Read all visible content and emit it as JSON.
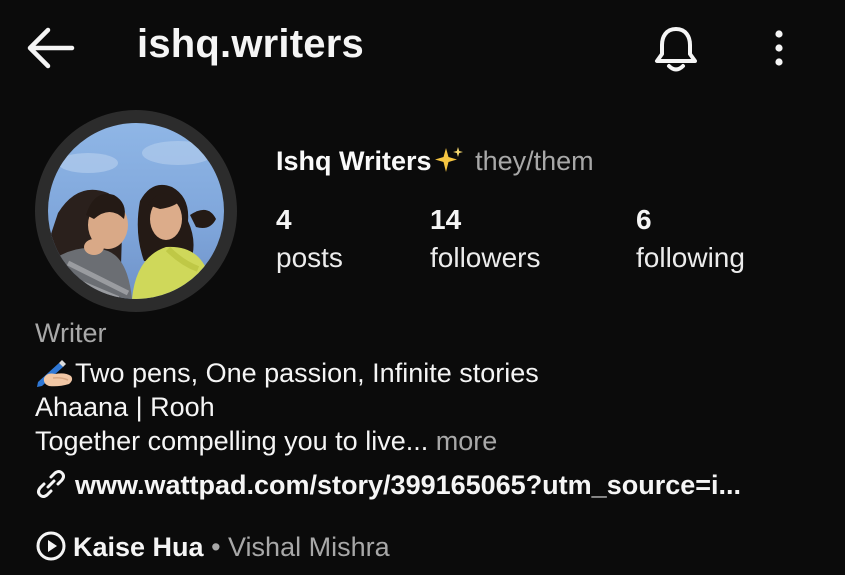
{
  "header": {
    "back_icon": "arrow-left-icon",
    "username": "ishq.writers",
    "bell_icon": "bell-icon",
    "menu_icon": "more-vertical-icon"
  },
  "profile": {
    "display_name": "Ishq Writers",
    "name_emoji": "sparkles-icon",
    "pronouns": "they/them",
    "stats": [
      {
        "value": "4",
        "label": "posts"
      },
      {
        "value": "14",
        "label": "followers"
      },
      {
        "value": "6",
        "label": "following"
      }
    ]
  },
  "bio": {
    "category": "Writer",
    "line1_emoji": "writing-hand-icon",
    "line1": "Two pens, One passion, Infinite stories",
    "line2": "Ahaana | Rooh",
    "line3": "Together compelling you to live...",
    "more_label": "more",
    "link_icon": "link-icon",
    "link": "www.wattpad.com/story/399165065?utm_source=i..."
  },
  "music": {
    "icon": "play-circle-icon",
    "song": "Kaise Hua",
    "separator": " • ",
    "artist": "Vishal Mishra"
  },
  "colors": {
    "background": "#0b0b0b",
    "text": "#f5f5f5",
    "muted": "#a8a8a8",
    "sparkle": "#f5c542"
  }
}
